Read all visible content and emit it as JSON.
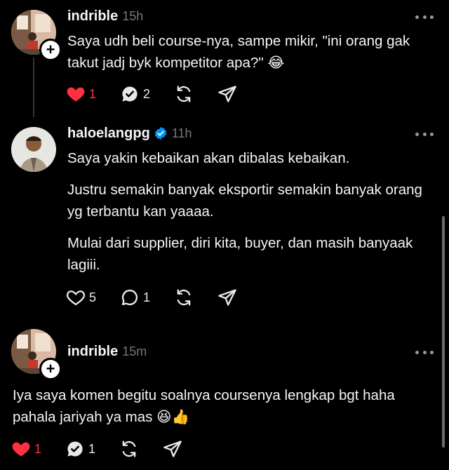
{
  "posts": [
    {
      "username": "indrible",
      "time": "15h",
      "verified": false,
      "paragraphs": [
        "Saya udh beli course-nya, sampe mikir, \"ini orang gak takut jadj byk kompetitor apa?\" 😂"
      ],
      "likes": "1",
      "liked": true,
      "replies": "2",
      "replied": true
    },
    {
      "username": "haloelangpg",
      "time": "11h",
      "verified": true,
      "paragraphs": [
        "Saya yakin kebaikan akan dibalas kebaikan.",
        "Justru semakin banyak eksportir semakin banyak orang yg terbantu kan yaaaa.",
        "Mulai dari supplier, diri kita, buyer, dan masih banyaak lagiii."
      ],
      "likes": "5",
      "liked": false,
      "replies": "1",
      "replied": false
    },
    {
      "username": "indrible",
      "time": "15m",
      "verified": false,
      "paragraphs": [
        "Iya saya komen begitu soalnya coursenya lengkap bgt haha pahala jariyah ya mas 😆👍"
      ],
      "likes": "1",
      "liked": true,
      "replies": "1",
      "replied": true
    }
  ],
  "colors": {
    "background": "#000000",
    "text": "#f3f5f7",
    "muted": "#777777",
    "like_red": "#ff3040",
    "verified_blue": "#0095f6"
  },
  "icons": [
    "heart-icon",
    "comment-icon",
    "repost-icon",
    "share-icon",
    "more-icon",
    "verified-icon",
    "follow-plus-icon"
  ]
}
